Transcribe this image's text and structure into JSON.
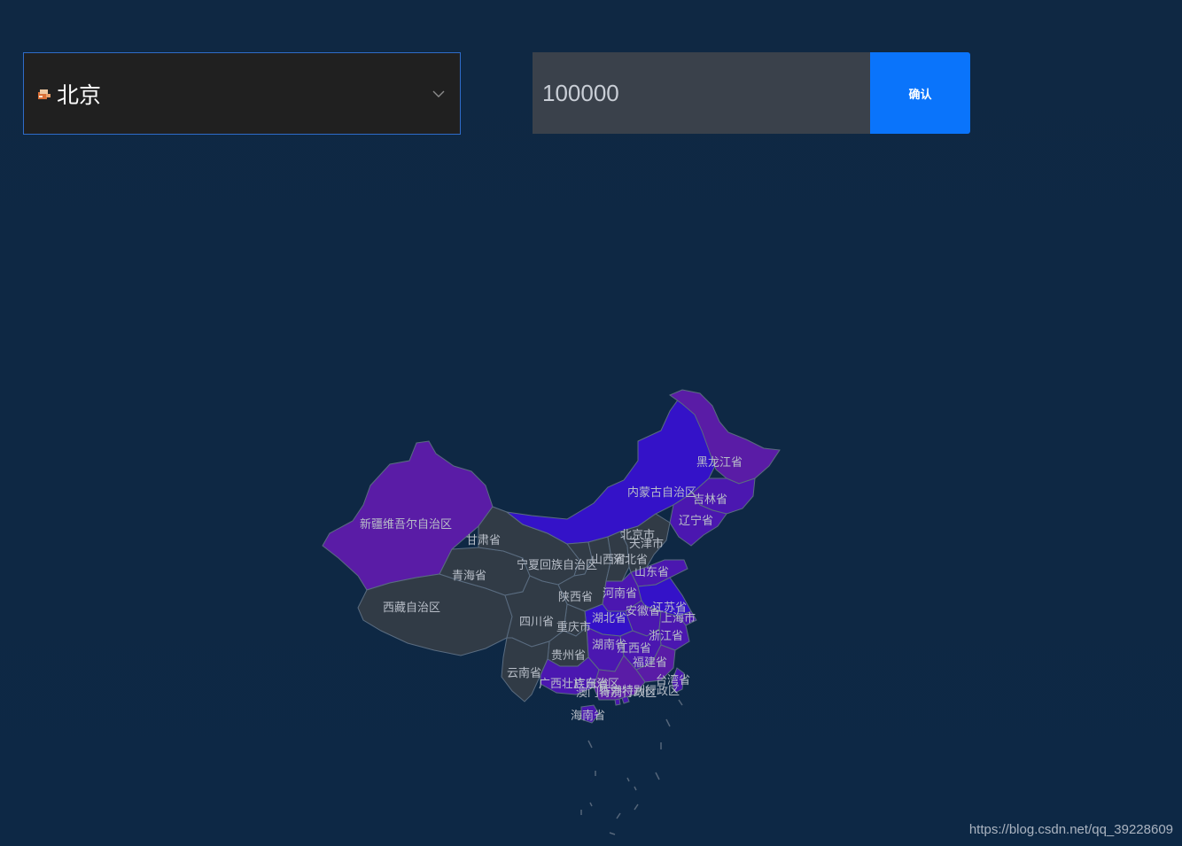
{
  "controls": {
    "province_select": {
      "value": "北京"
    },
    "amount_input": {
      "value": "100000"
    },
    "confirm_label": "确认"
  },
  "colors": {
    "background": "#0e2742",
    "select_bg": "#202020",
    "select_border": "#2f6cc9",
    "input_bg": "#3a414b",
    "button": "#0a74fb",
    "map_gray": "#313b46",
    "map_purple": "#4b17b0",
    "map_violet": "#5a1ca6",
    "map_blue": "#3412c8"
  },
  "icons": {
    "select_item_icon": "province-flag-icon",
    "dropdown": "chevron-down-icon"
  },
  "map": {
    "provinces": [
      {
        "name": "黑龙江省",
        "level": "high"
      },
      {
        "name": "内蒙古自治区",
        "level": "high"
      },
      {
        "name": "吉林省",
        "level": "high"
      },
      {
        "name": "辽宁省",
        "level": "high"
      },
      {
        "name": "新疆维吾尔自治区",
        "level": "high"
      },
      {
        "name": "甘肃省",
        "level": "none"
      },
      {
        "name": "北京市",
        "level": "none"
      },
      {
        "name": "天津市",
        "level": "none"
      },
      {
        "name": "宁夏回族自治区",
        "level": "none"
      },
      {
        "name": "山西省",
        "level": "none"
      },
      {
        "name": "河北省",
        "level": "none"
      },
      {
        "name": "青海省",
        "level": "none"
      },
      {
        "name": "山东省",
        "level": "high"
      },
      {
        "name": "陕西省",
        "level": "none"
      },
      {
        "name": "河南省",
        "level": "high"
      },
      {
        "name": "西藏自治区",
        "level": "none"
      },
      {
        "name": "江苏省",
        "level": "high"
      },
      {
        "name": "四川省",
        "level": "none"
      },
      {
        "name": "湖北省",
        "level": "high"
      },
      {
        "name": "安徽省",
        "level": "high"
      },
      {
        "name": "上海市",
        "level": "high"
      },
      {
        "name": "重庆市",
        "level": "none"
      },
      {
        "name": "浙江省",
        "level": "high"
      },
      {
        "name": "湖南省",
        "level": "high"
      },
      {
        "name": "江西省",
        "level": "high"
      },
      {
        "name": "贵州省",
        "level": "none"
      },
      {
        "name": "福建省",
        "level": "high"
      },
      {
        "name": "云南省",
        "level": "none"
      },
      {
        "name": "台湾省",
        "level": "high"
      },
      {
        "name": "广西壮族自治区",
        "level": "high"
      },
      {
        "name": "广东省",
        "level": "high"
      },
      {
        "name": "香港特别行政区",
        "level": "high"
      },
      {
        "name": "澳门特别行政区",
        "level": "high"
      },
      {
        "name": "海南省",
        "level": "high"
      }
    ]
  },
  "watermark": "https://blog.csdn.net/qq_39228609"
}
